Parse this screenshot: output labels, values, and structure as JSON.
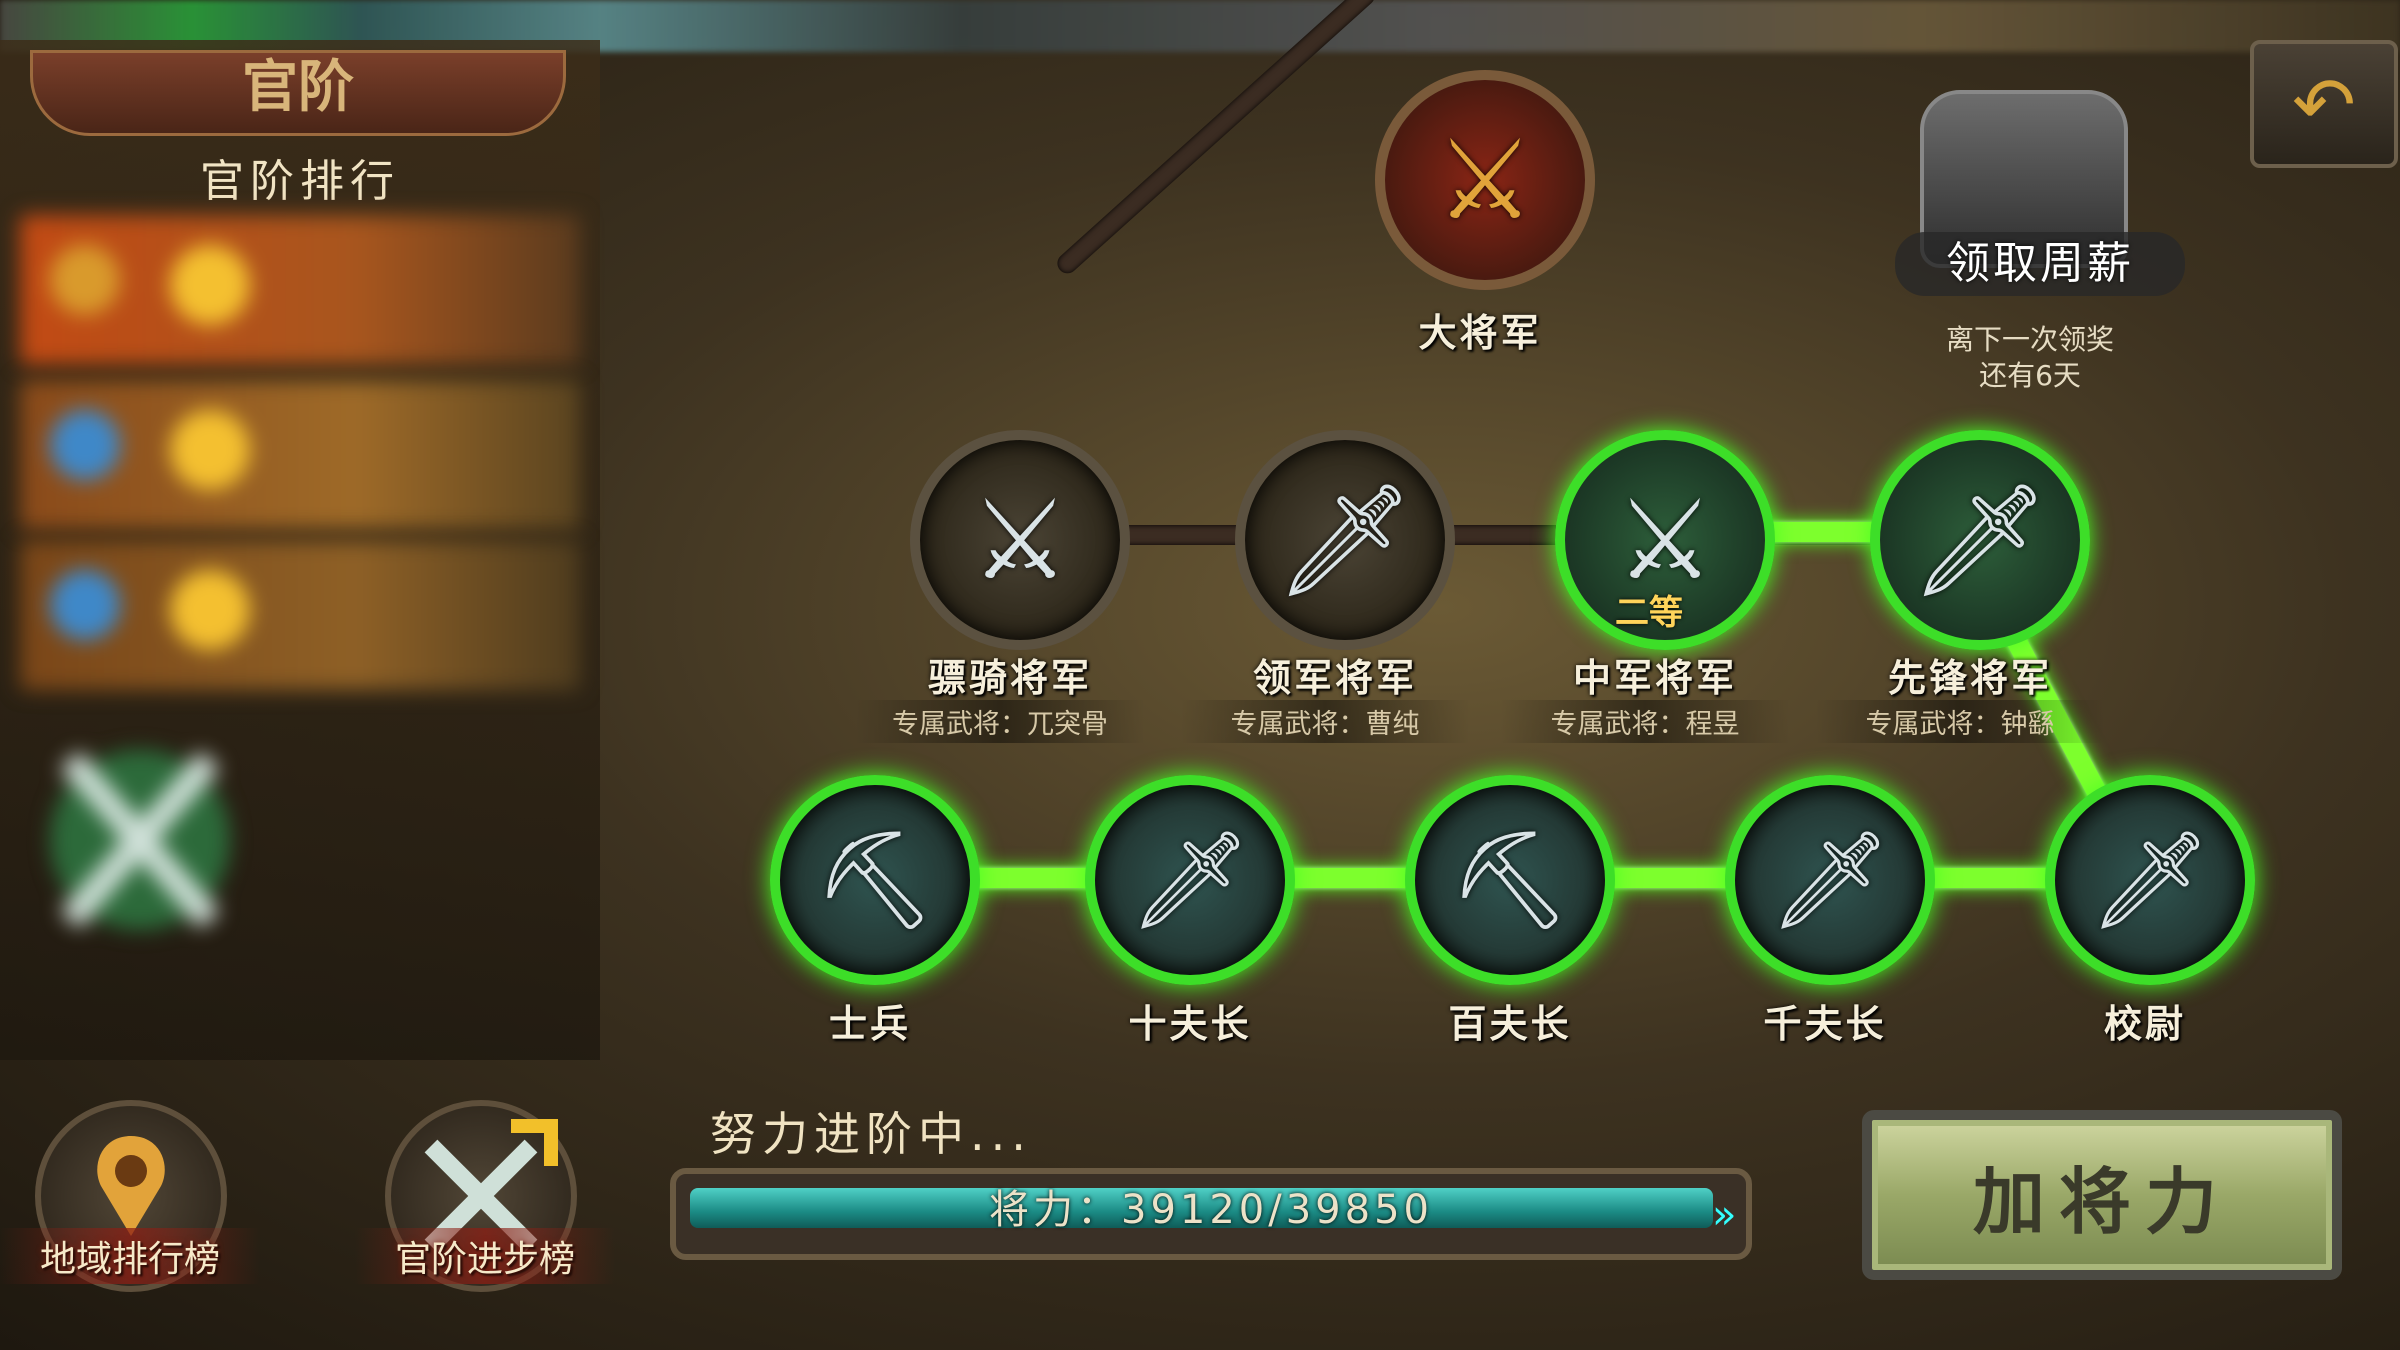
{
  "panel": {
    "tab_title": "官阶",
    "ranking_header": "官阶排行"
  },
  "ranks": {
    "top": {
      "label": "大将军"
    },
    "generals": [
      {
        "label": "骠骑将军",
        "exclusive": "专属武将：兀突骨",
        "state": "locked"
      },
      {
        "label": "领军将军",
        "exclusive": "专属武将：曹纯",
        "state": "locked"
      },
      {
        "label": "中军将军",
        "exclusive": "专属武将：程昱",
        "state": "current",
        "badge": "二等"
      },
      {
        "label": "先锋将军",
        "exclusive": "专属武将：钟繇",
        "state": "done"
      }
    ],
    "basic": [
      {
        "label": "士兵",
        "icon": "axe-icon"
      },
      {
        "label": "十夫长",
        "icon": "dagger-icon"
      },
      {
        "label": "百夫长",
        "icon": "halberd-icon"
      },
      {
        "label": "千夫长",
        "icon": "sword-icon"
      },
      {
        "label": "校尉",
        "icon": "glaive-icon"
      }
    ]
  },
  "weekly": {
    "label": "领取周薪",
    "note_line1": "离下一次领奖",
    "note_line2": "还有6天"
  },
  "progress": {
    "title": "努力进阶中...",
    "text": "将力：39120/39850",
    "current": 39120,
    "max": 39850
  },
  "buttons": {
    "add_power": "加将力",
    "region_rank": "地域排行榜",
    "rank_progress": "官阶进步榜"
  },
  "colors": {
    "active_green": "#3dde28",
    "progress_teal": "#1b8a84",
    "top_red": "#8a2515"
  }
}
